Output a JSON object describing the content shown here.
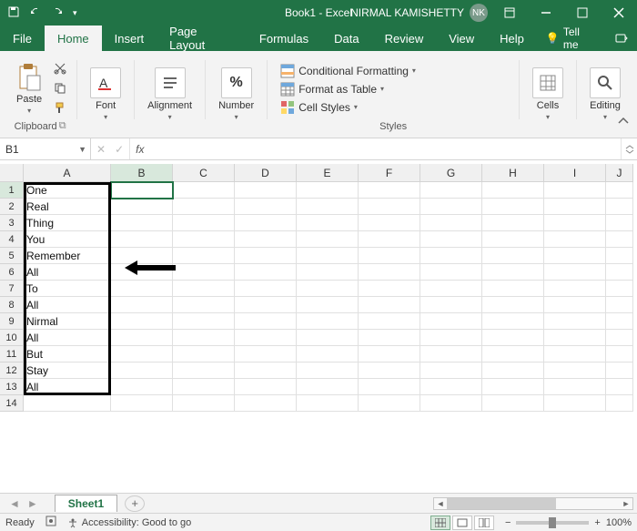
{
  "title": "Book1 - Excel",
  "user_name": "NIRMAL KAMISHETTY",
  "user_initials": "NK",
  "tabs": {
    "file": "File",
    "home": "Home",
    "insert": "Insert",
    "page_layout": "Page Layout",
    "formulas": "Formulas",
    "data": "Data",
    "review": "Review",
    "view": "View",
    "help": "Help",
    "tell_me": "Tell me"
  },
  "ribbon": {
    "clipboard": {
      "paste": "Paste",
      "label": "Clipboard"
    },
    "font": {
      "btn": "Font"
    },
    "alignment": {
      "btn": "Alignment"
    },
    "number": {
      "btn": "Number"
    },
    "styles": {
      "cond": "Conditional Formatting",
      "table": "Format as Table",
      "cell": "Cell Styles",
      "label": "Styles"
    },
    "cells": {
      "btn": "Cells"
    },
    "editing": {
      "btn": "Editing"
    }
  },
  "namebox": "B1",
  "fx": "fx",
  "formula_value": "",
  "columns": [
    "A",
    "B",
    "C",
    "D",
    "E",
    "F",
    "G",
    "H",
    "I",
    "J"
  ],
  "row_count": 14,
  "col_a": [
    "One",
    "Real",
    "Thing",
    "You",
    "Remember",
    "All",
    "To",
    "All",
    "Nirmal",
    "All",
    "But",
    "Stay",
    "All",
    ""
  ],
  "selected_cell": "B1",
  "sheet": {
    "name": "Sheet1"
  },
  "status": {
    "ready": "Ready",
    "acc": "Accessibility: Good to go",
    "zoom": "100%"
  }
}
